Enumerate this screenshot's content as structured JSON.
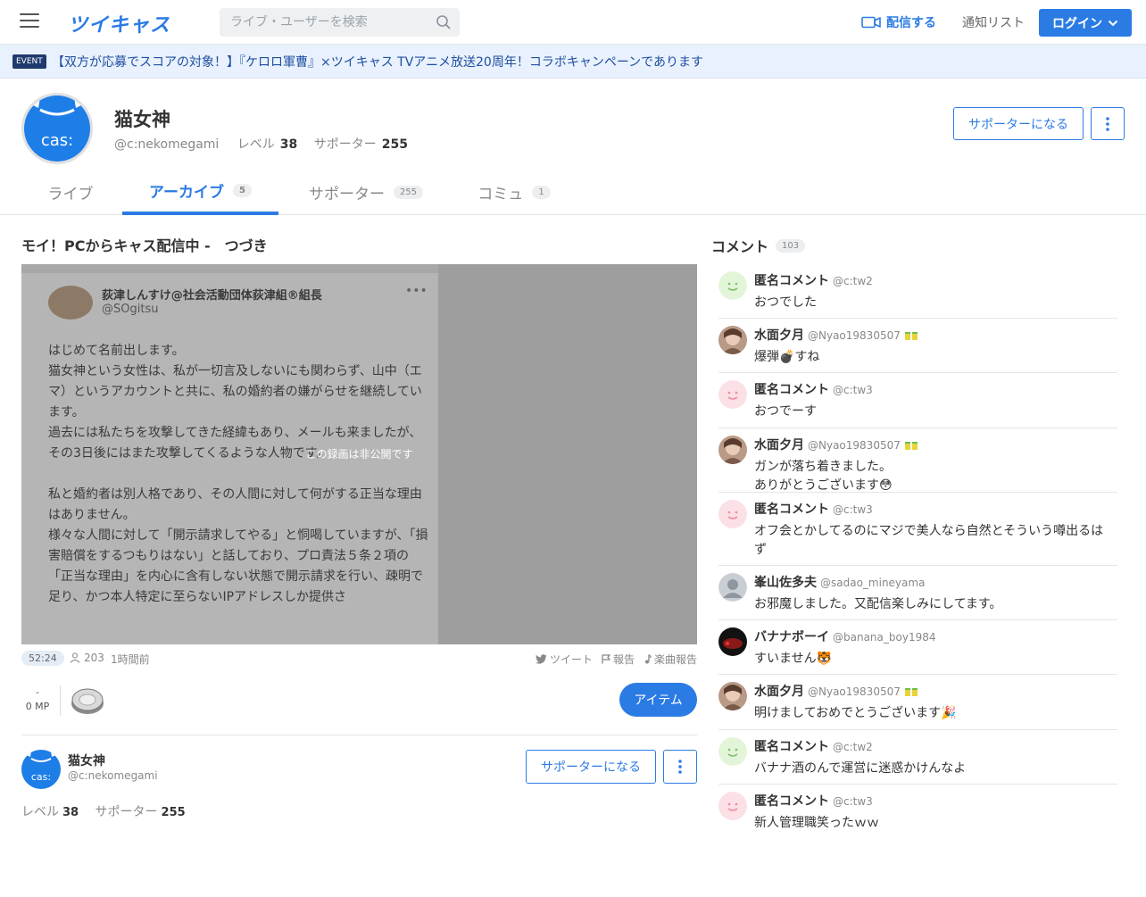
{
  "header": {
    "logo": "ツイキャス",
    "search_placeholder": "ライブ・ユーザーを検索",
    "broadcast_label": "配信する",
    "notify_label": "通知リスト",
    "login_label": "ログイン"
  },
  "event": {
    "badge": "EVENT",
    "text": "【双方が応募でスコアの対象！】『ケロロ軍曹』×ツイキャス TVアニメ放送20周年！コラボキャンペーンであります"
  },
  "profile": {
    "name": "猫女神",
    "handle": "@c:nekomegami",
    "level_label": "レベル",
    "level": "38",
    "supporter_label": "サポーター",
    "supporters": "255",
    "support_button": "サポーターになる",
    "avatar_text": "cas:"
  },
  "tabs": [
    {
      "label": "ライブ",
      "count": ""
    },
    {
      "label": "アーカイブ",
      "count": "5"
    },
    {
      "label": "サポーター",
      "count": "255"
    },
    {
      "label": "コミュ",
      "count": "1"
    }
  ],
  "movie": {
    "title": "モイ！PCからキャス配信中 -　つづき",
    "private_message": "この録画は非公開です",
    "duration": "52:24",
    "views": "203",
    "ago": "1時間前",
    "tweet_label": "ツイート",
    "report_label": "報告",
    "music_report_label": "楽曲報告",
    "mp_value": "-",
    "mp_label": "0 MP",
    "item_button": "アイテム",
    "screenshot": {
      "name": "荻津しんすけ@社会活動団体荻津組®組長",
      "handle": "@SOgitsu",
      "body": "はじめて名前出します。\n猫女神という女性は、私が一切言及しないにも関わらず、山中（エマ）というアカウントと共に、私の婚約者の嫌がらせを継続しています。\n過去には私たちを攻撃してきた経緯もあり、メールも来ましたが、その3日後にはまた攻撃してくるような人物です。\n\n私と婚約者は別人格であり、その人間に対して何がする正当な理由はありません。\n様々な人間に対して「開示請求してやる」と恫喝していますが、「損害賠償をするつもりはない」と話しており、プロ責法５条２項の「正当な理由」を内心に含有しない状態で開示請求を行い、疎明で足り、かつ本人特定に至らないIPアドレスしか提供さ"
    }
  },
  "broadcaster": {
    "name": "猫女神",
    "handle": "@c:nekomegami",
    "level_label": "レベル",
    "level": "38",
    "supporter_label": "サポーター",
    "supporters": "255",
    "support_button": "サポーターになる"
  },
  "comments_section": {
    "title": "コメント",
    "count": "103",
    "items": [
      {
        "name": "匿名コメント",
        "handle": "@c:tw2",
        "text": "おつでした",
        "avatar": "anon-green",
        "badge": false
      },
      {
        "name": "水面夕月",
        "handle": "@Nyao19830507",
        "text": "爆弾💣すね",
        "avatar": "photo",
        "badge": true
      },
      {
        "name": "匿名コメント",
        "handle": "@c:tw3",
        "text": "おつでーす",
        "avatar": "anon-pink",
        "badge": false
      },
      {
        "name": "水面夕月",
        "handle": "@Nyao19830507",
        "text": "ガンが落ち着きました。\nありがとうございます😳",
        "avatar": "photo",
        "badge": true
      },
      {
        "name": "匿名コメント",
        "handle": "@c:tw3",
        "text": "オフ会とかしてるのにマジで美人なら自然とそういう噂出るはず",
        "avatar": "anon-pink",
        "badge": false
      },
      {
        "name": "峯山佐多夫",
        "handle": "@sadao_mineyama",
        "text": "お邪魔しました。又配信楽しみにしてます。",
        "avatar": "default",
        "badge": false
      },
      {
        "name": "バナナボーイ",
        "handle": "@banana_boy1984",
        "text": "すいません🐯",
        "avatar": "dark",
        "badge": false
      },
      {
        "name": "水面夕月",
        "handle": "@Nyao19830507",
        "text": "明けましておめでとうございます🎉",
        "avatar": "photo",
        "badge": true
      },
      {
        "name": "匿名コメント",
        "handle": "@c:tw2",
        "text": "バナナ酒のんで運営に迷惑かけんなよ",
        "avatar": "anon-green",
        "badge": false
      },
      {
        "name": "匿名コメント",
        "handle": "@c:tw3",
        "text": "新人管理職笑ったｗｗ",
        "avatar": "anon-pink",
        "badge": false
      }
    ]
  },
  "colors": {
    "accent": "#2b7be4",
    "event_bg": "#e8f1fd",
    "anon_green": "#e3f5d8",
    "anon_pink": "#fbe0e6"
  }
}
